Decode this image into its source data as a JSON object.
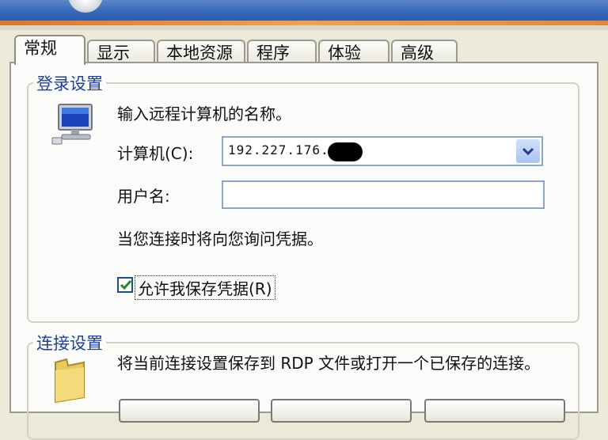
{
  "tabs": [
    {
      "label": "常规"
    },
    {
      "label": "显示"
    },
    {
      "label": "本地资源"
    },
    {
      "label": "程序"
    },
    {
      "label": "体验"
    },
    {
      "label": "高级"
    }
  ],
  "login_group": {
    "title": "登录设置",
    "prompt": "输入远程计算机的名称。",
    "computer_label": "计算机(C):",
    "computer_value": "192.227.176.",
    "username_label": "用户名:",
    "username_value": "",
    "credentials_note": "当您连接时将向您询问凭据。",
    "save_credentials_label": "允许我保存凭据(R)",
    "save_credentials_checked": true
  },
  "connect_group": {
    "title": "连接设置",
    "description": "将当前连接设置保存到 RDP 文件或打开一个已保存的连接。"
  }
}
